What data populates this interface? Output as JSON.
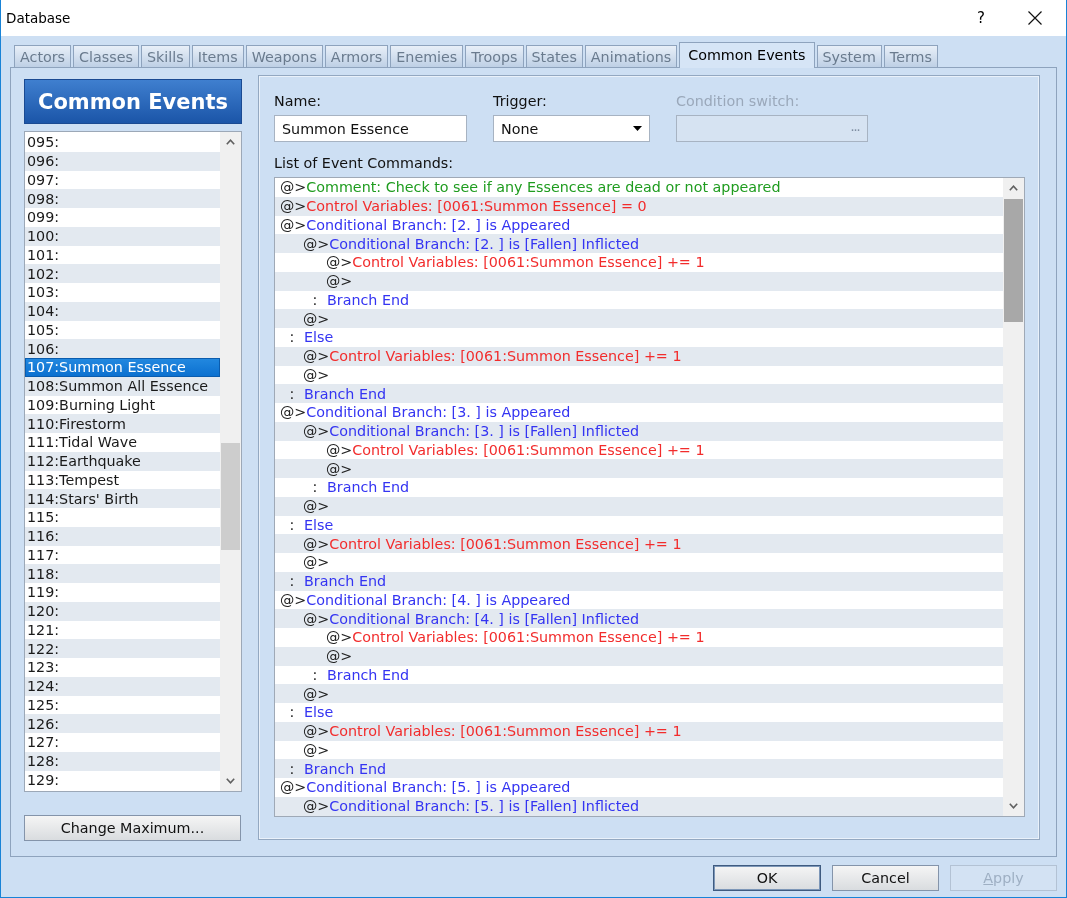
{
  "window": {
    "title": "Database",
    "help": "?"
  },
  "tabs": [
    {
      "label": "Actors",
      "selected": false
    },
    {
      "label": "Classes",
      "selected": false
    },
    {
      "label": "Skills",
      "selected": false
    },
    {
      "label": "Items",
      "selected": false
    },
    {
      "label": "Weapons",
      "selected": false
    },
    {
      "label": "Armors",
      "selected": false
    },
    {
      "label": "Enemies",
      "selected": false
    },
    {
      "label": "Troops",
      "selected": false
    },
    {
      "label": "States",
      "selected": false
    },
    {
      "label": "Animations",
      "selected": false
    },
    {
      "label": "Common Events",
      "selected": true
    },
    {
      "label": "System",
      "selected": false
    },
    {
      "label": "Terms",
      "selected": false
    }
  ],
  "sidebar": {
    "title": "Common Events",
    "items": [
      {
        "label": "095:",
        "selected": false
      },
      {
        "label": "096:",
        "selected": false
      },
      {
        "label": "097:",
        "selected": false
      },
      {
        "label": "098:",
        "selected": false
      },
      {
        "label": "099:",
        "selected": false
      },
      {
        "label": "100:",
        "selected": false
      },
      {
        "label": "101:",
        "selected": false
      },
      {
        "label": "102:",
        "selected": false
      },
      {
        "label": "103:",
        "selected": false
      },
      {
        "label": "104:",
        "selected": false
      },
      {
        "label": "105:",
        "selected": false
      },
      {
        "label": "106:",
        "selected": false
      },
      {
        "label": "107:Summon Essence",
        "selected": true
      },
      {
        "label": "108:Summon All Essence",
        "selected": false
      },
      {
        "label": "109:Burning Light",
        "selected": false
      },
      {
        "label": "110:Firestorm",
        "selected": false
      },
      {
        "label": "111:Tidal Wave",
        "selected": false
      },
      {
        "label": "112:Earthquake",
        "selected": false
      },
      {
        "label": "113:Tempest",
        "selected": false
      },
      {
        "label": "114:Stars' Birth",
        "selected": false
      },
      {
        "label": "115:",
        "selected": false
      },
      {
        "label": "116:",
        "selected": false
      },
      {
        "label": "117:",
        "selected": false
      },
      {
        "label": "118:",
        "selected": false
      },
      {
        "label": "119:",
        "selected": false
      },
      {
        "label": "120:",
        "selected": false
      },
      {
        "label": "121:",
        "selected": false
      },
      {
        "label": "122:",
        "selected": false
      },
      {
        "label": "123:",
        "selected": false
      },
      {
        "label": "124:",
        "selected": false
      },
      {
        "label": "125:",
        "selected": false
      },
      {
        "label": "126:",
        "selected": false
      },
      {
        "label": "127:",
        "selected": false
      },
      {
        "label": "128:",
        "selected": false
      },
      {
        "label": "129:",
        "selected": false
      }
    ],
    "button": "Change Maximum..."
  },
  "fields": [
    {
      "kind": "text",
      "label": "Name:",
      "value": "Summon Essence",
      "disabled": false
    },
    {
      "kind": "dropdown",
      "label": "Trigger:",
      "value": "None",
      "disabled": false
    },
    {
      "kind": "picker",
      "label": "Condition switch:",
      "button": "...",
      "disabled": true
    }
  ],
  "commands": {
    "label": "List of Event Commands:",
    "items": [
      {
        "marker": "@>",
        "kind": "comment",
        "text": "Comment: Check to see if any Essences are dead or not appeared"
      },
      {
        "marker": "@>",
        "kind": "variable",
        "text": "Control Variables: [0061:Summon Essence] = 0"
      },
      {
        "marker": "@>",
        "kind": "branch",
        "text": "Conditional Branch: [2. ] is Appeared",
        "children": [
          {
            "marker": "@>",
            "kind": "branch",
            "text": "Conditional Branch: [2. ] is [Fallen] Inflicted",
            "children": [
              {
                "marker": "@>",
                "kind": "variable",
                "text": "Control Variables: [0061:Summon Essence] += 1"
              },
              {
                "marker": "@>"
              }
            ]
          },
          {
            "marker": ":",
            "kind": "branch",
            "text": "Branch End"
          },
          {
            "marker": "@>"
          }
        ]
      },
      {
        "marker": ":",
        "kind": "branch",
        "text": "Else",
        "children": [
          {
            "marker": "@>",
            "kind": "variable",
            "text": "Control Variables: [0061:Summon Essence] += 1"
          },
          {
            "marker": "@>"
          }
        ]
      },
      {
        "marker": ":",
        "kind": "branch",
        "text": "Branch End"
      },
      {
        "marker": "@>",
        "kind": "branch",
        "text": "Conditional Branch: [3. ] is Appeared",
        "children": [
          {
            "marker": "@>",
            "kind": "branch",
            "text": "Conditional Branch: [3. ] is [Fallen] Inflicted",
            "children": [
              {
                "marker": "@>",
                "kind": "variable",
                "text": "Control Variables: [0061:Summon Essence] += 1"
              },
              {
                "marker": "@>"
              }
            ]
          },
          {
            "marker": ":",
            "kind": "branch",
            "text": "Branch End"
          },
          {
            "marker": "@>"
          }
        ]
      },
      {
        "marker": ":",
        "kind": "branch",
        "text": "Else",
        "children": [
          {
            "marker": "@>",
            "kind": "variable",
            "text": "Control Variables: [0061:Summon Essence] += 1"
          },
          {
            "marker": "@>"
          }
        ]
      },
      {
        "marker": ":",
        "kind": "branch",
        "text": "Branch End"
      },
      {
        "marker": "@>",
        "kind": "branch",
        "text": "Conditional Branch: [4. ] is Appeared",
        "children": [
          {
            "marker": "@>",
            "kind": "branch",
            "text": "Conditional Branch: [4. ] is [Fallen] Inflicted",
            "children": [
              {
                "marker": "@>",
                "kind": "variable",
                "text": "Control Variables: [0061:Summon Essence] += 1"
              },
              {
                "marker": "@>"
              }
            ]
          },
          {
            "marker": ":",
            "kind": "branch",
            "text": "Branch End"
          },
          {
            "marker": "@>"
          }
        ]
      },
      {
        "marker": ":",
        "kind": "branch",
        "text": "Else",
        "children": [
          {
            "marker": "@>",
            "kind": "variable",
            "text": "Control Variables: [0061:Summon Essence] += 1"
          },
          {
            "marker": "@>"
          }
        ]
      },
      {
        "marker": ":",
        "kind": "branch",
        "text": "Branch End"
      },
      {
        "marker": "@>",
        "kind": "branch",
        "text": "Conditional Branch: [5. ] is Appeared",
        "children": [
          {
            "marker": "@>",
            "kind": "branch",
            "text": "Conditional Branch: [5. ] is [Fallen] Inflicted"
          }
        ]
      }
    ]
  },
  "buttons": [
    {
      "label": "OK",
      "default": true,
      "disabled": false,
      "mnemonic": false
    },
    {
      "label": "Cancel",
      "default": false,
      "disabled": false,
      "mnemonic": false
    },
    {
      "label": "Apply",
      "default": false,
      "disabled": true,
      "mnemonic": true
    }
  ]
}
